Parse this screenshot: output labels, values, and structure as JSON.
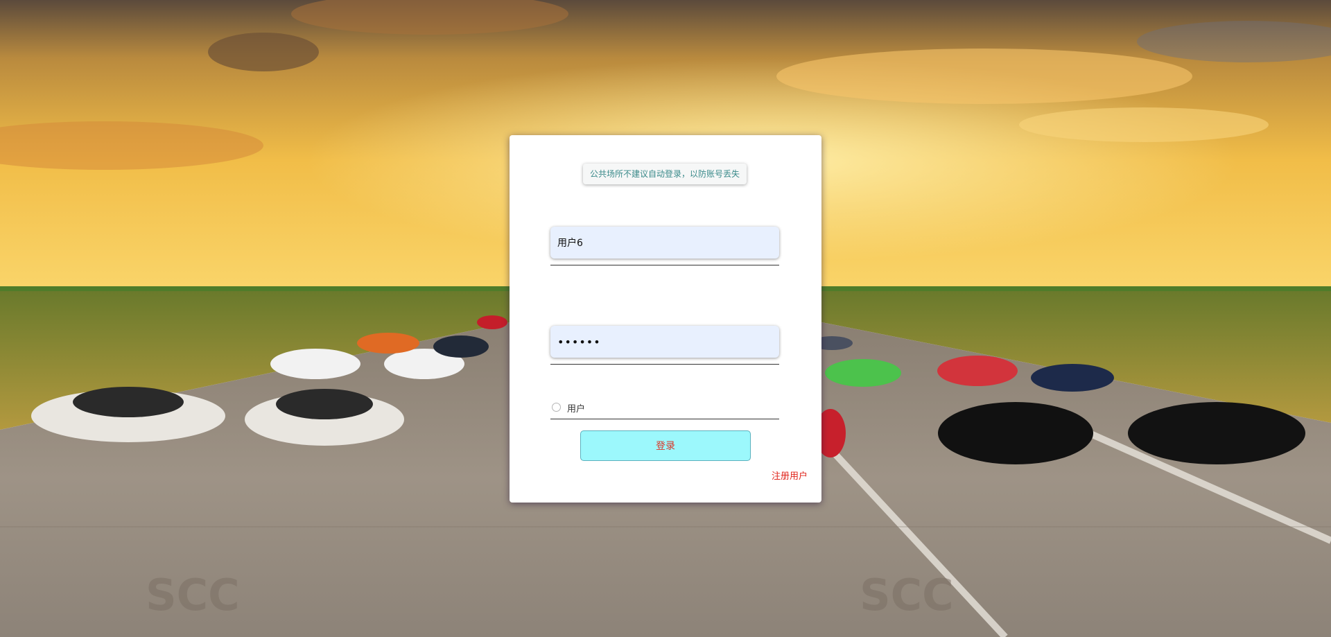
{
  "login": {
    "notice": "公共场所不建议自动登录，以防账号丢失",
    "username_value": "用户6",
    "password_value": "••••••",
    "role_option_label": "用户",
    "submit_label": "登录",
    "register_label": "注册用户"
  },
  "colors": {
    "notice_text": "#3a8a8a",
    "input_bg": "#e8f0fe",
    "button_bg": "#9cf8fc",
    "button_text": "#d9382a",
    "register_link": "#e0241b"
  },
  "background": {
    "scene": "sports cars lined up on a runway at sunset"
  }
}
